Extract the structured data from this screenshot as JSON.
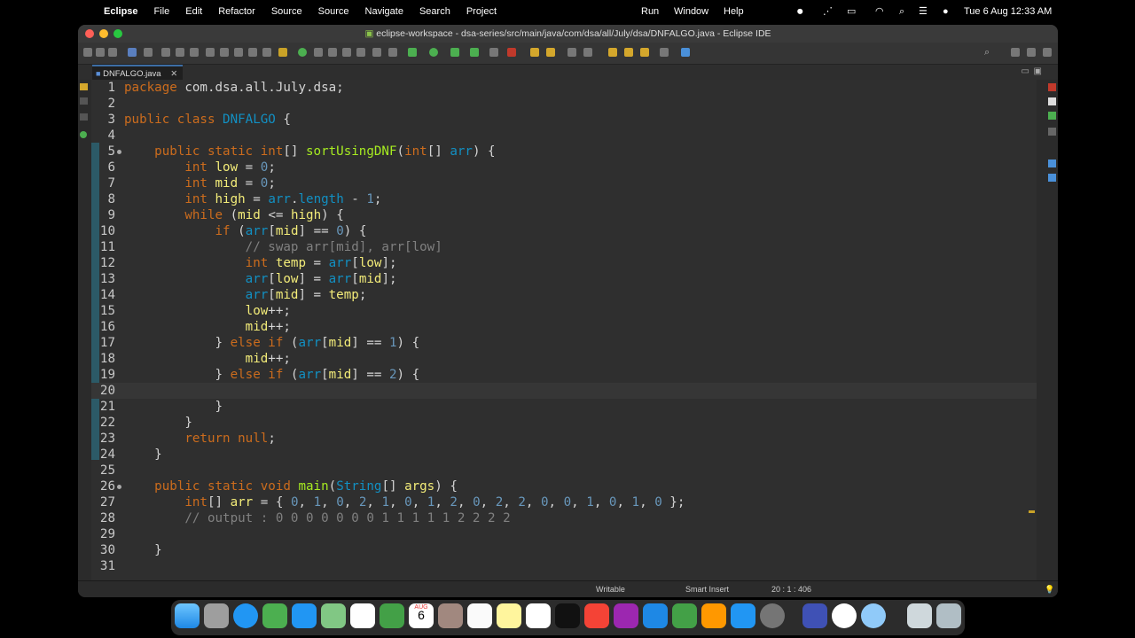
{
  "menubar": {
    "app": "Eclipse",
    "items": [
      "File",
      "Edit",
      "Refactor",
      "Source",
      "Source",
      "Navigate",
      "Search",
      "Project",
      "Run",
      "Window",
      "Help"
    ],
    "datetime": "Tue 6 Aug  12:33 AM"
  },
  "window": {
    "title": "eclipse-workspace - dsa-series/src/main/java/com/dsa/all/July/dsa/DNFALGO.java - Eclipse IDE",
    "tab": {
      "label": "DNFALGO.java",
      "close": "✕"
    }
  },
  "editor": {
    "lines": [
      {
        "n": "1",
        "html": "<span class='kw'>package</span> com.dsa.all.July.dsa;"
      },
      {
        "n": "2",
        "html": ""
      },
      {
        "n": "3",
        "html": "<span class='kw'>public class</span> <span class='cls'>DNFALGO</span> {"
      },
      {
        "n": "4",
        "html": ""
      },
      {
        "n": "5",
        "html": "    <span class='kw'>public static</span> <span class='ty'>int</span>[] <span class='fn'>sortUsingDNF</span>(<span class='ty'>int</span>[] <span class='cls'>arr</span>) {"
      },
      {
        "n": "6",
        "html": "        <span class='ty'>int</span> <span class='vr'>low</span> = <span class='num'>0</span>;"
      },
      {
        "n": "7",
        "html": "        <span class='ty'>int</span> <span class='vr'>mid</span> = <span class='num'>0</span>;"
      },
      {
        "n": "8",
        "html": "        <span class='ty'>int</span> <span class='vr'>high</span> = <span class='cls'>arr</span>.<span class='cls'>length</span> - <span class='num'>1</span>;"
      },
      {
        "n": "9",
        "html": "        <span class='kw'>while</span> (<span class='vr'>mid</span> &lt;= <span class='vr'>high</span>) {"
      },
      {
        "n": "10",
        "html": "            <span class='kw'>if</span> (<span class='cls'>arr</span>[<span class='vr'>mid</span>] == <span class='num'>0</span>) {"
      },
      {
        "n": "11",
        "html": "                <span class='cm'>// swap arr[mid], arr[low]</span>"
      },
      {
        "n": "12",
        "html": "                <span class='ty'>int</span> <span class='vr'>temp</span> = <span class='cls'>arr</span>[<span class='vr'>low</span>];"
      },
      {
        "n": "13",
        "html": "                <span class='cls'>arr</span>[<span class='vr'>low</span>] = <span class='cls'>arr</span>[<span class='vr'>mid</span>];"
      },
      {
        "n": "14",
        "html": "                <span class='cls'>arr</span>[<span class='vr'>mid</span>] = <span class='vr'>temp</span>;"
      },
      {
        "n": "15",
        "html": "                <span class='vr'>low</span>++;"
      },
      {
        "n": "16",
        "html": "                <span class='vr'>mid</span>++;"
      },
      {
        "n": "17",
        "html": "            } <span class='kw'>else if</span> (<span class='cls'>arr</span>[<span class='vr'>mid</span>] == <span class='num'>1</span>) {"
      },
      {
        "n": "18",
        "html": "                <span class='vr'>mid</span>++;"
      },
      {
        "n": "19",
        "html": "            } <span class='kw'>else if</span> (<span class='cls'>arr</span>[<span class='vr'>mid</span>] == <span class='num'>2</span>) {"
      },
      {
        "n": "20",
        "html": ""
      },
      {
        "n": "21",
        "html": "            }"
      },
      {
        "n": "22",
        "html": "        }"
      },
      {
        "n": "23",
        "html": "        <span class='kw'>return null</span>;"
      },
      {
        "n": "24",
        "html": "    }"
      },
      {
        "n": "25",
        "html": ""
      },
      {
        "n": "26",
        "html": "    <span class='kw'>public static void</span> <span class='fn'>main</span>(<span class='cls'>String</span>[] <span class='vr'>args</span>) {"
      },
      {
        "n": "27",
        "html": "        <span class='ty'>int</span>[] <span class='vr'>arr</span> = { <span class='num'>0</span>, <span class='num'>1</span>, <span class='num'>0</span>, <span class='num'>2</span>, <span class='num'>1</span>, <span class='num'>0</span>, <span class='num'>1</span>, <span class='num'>2</span>, <span class='num'>0</span>, <span class='num'>2</span>, <span class='num'>2</span>, <span class='num'>0</span>, <span class='num'>0</span>, <span class='num'>1</span>, <span class='num'>0</span>, <span class='num'>1</span>, <span class='num'>0</span> };"
      },
      {
        "n": "28",
        "html": "        <span class='cm'>// output : 0 0 0 0 0 0 0 1 1 1 1 1 2 2 2 2</span>"
      },
      {
        "n": "29",
        "html": ""
      },
      {
        "n": "30",
        "html": "    }"
      },
      {
        "n": "31",
        "html": ""
      }
    ],
    "current_line": 20
  },
  "status": {
    "mode": "Writable",
    "insert": "Smart Insert",
    "position": "20 : 1 : 406"
  },
  "dock": {
    "calendar_month": "AUG",
    "calendar_day": "6"
  },
  "colors": {
    "keyword": "#cc6c1d",
    "class": "#1290c3",
    "method": "#a7ec21",
    "variable": "#f3ec79",
    "number": "#6897bb",
    "comment": "#808080"
  }
}
